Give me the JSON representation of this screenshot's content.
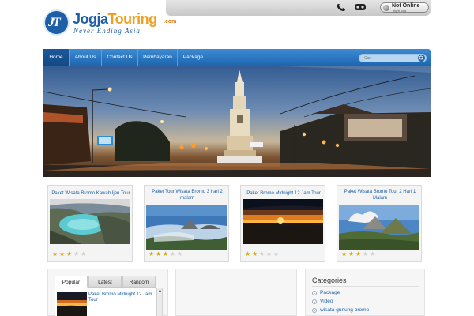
{
  "header": {
    "logo_mark": "JT",
    "logo_name_part1": "Jogja",
    "logo_name_part2": "Touring",
    "logo_dotcom": ".com",
    "logo_tagline": "Never Ending Asia",
    "messenger_icons": [
      "phone-icon",
      "yahoo-messenger-icon"
    ],
    "status": {
      "main": "Not Online",
      "sub": "right now"
    }
  },
  "nav": {
    "items": [
      {
        "label": "Home",
        "active": true
      },
      {
        "label": "About Us",
        "active": false
      },
      {
        "label": "Contact Us",
        "active": false
      },
      {
        "label": "Pembayaran",
        "active": false
      },
      {
        "label": "Package",
        "active": false
      }
    ],
    "search_placeholder": "Cari"
  },
  "cards": [
    {
      "title": "Paket Wisata Bromo Kawah Ijen Tour",
      "rating": 3,
      "max_rating": 5
    },
    {
      "title": "Paket Tour Wisata Bromo 3 hari 2 malam",
      "rating": 3,
      "max_rating": 5
    },
    {
      "title": "Paket Bromo Midnight 12 Jam Tour",
      "rating": 2,
      "max_rating": 5
    },
    {
      "title": "Paket Wisata Bromo Tour 2 Hari 1 Malam",
      "rating": 3,
      "max_rating": 5
    }
  ],
  "widget_tabs": {
    "tabs": [
      {
        "label": "Popular",
        "active": true
      },
      {
        "label": "Latest",
        "active": false
      },
      {
        "label": "Random",
        "active": false
      }
    ],
    "items": [
      {
        "title": "Paket Bromo Midnight 12 Jam Tour"
      }
    ]
  },
  "categories": {
    "title": "Categories",
    "items": [
      "Package",
      "Video",
      "wisata gunung bromo"
    ]
  },
  "colors": {
    "brand_blue": "#1d5fa6",
    "nav_gradient_top": "#3d8bd4",
    "star_gold": "#d9a400"
  }
}
